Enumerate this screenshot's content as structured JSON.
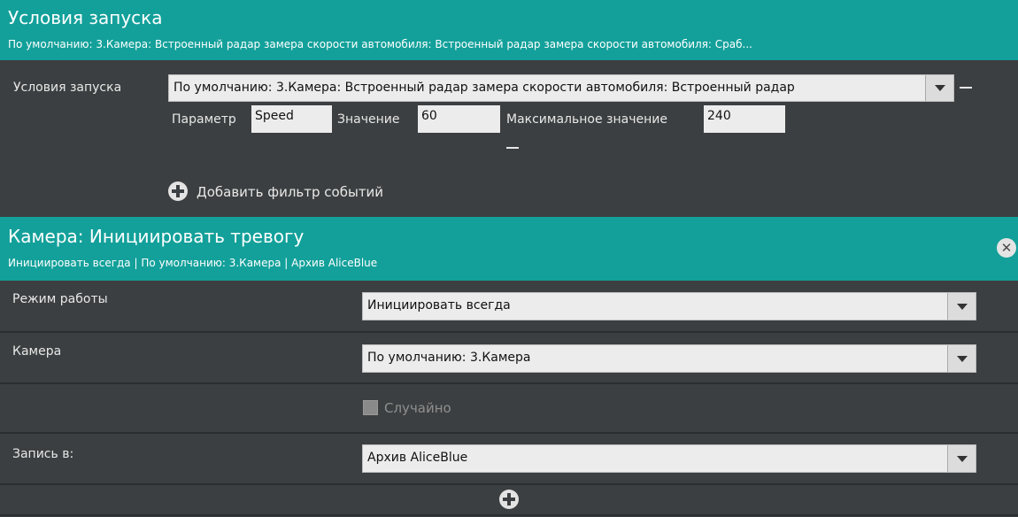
{
  "launch": {
    "title": "Условия запуска",
    "subtitle": "По умолчанию: 3.Камера: Встроенный радар замера скорости автомобиля: Встроенный радар замера скорости автомобиля: Сраб...",
    "row_label": "Условия запуска",
    "condition_value": "По умолчанию: 3.Камера: Встроенный радар замера скорости автомобиля: Встроенный радар",
    "param_label": "Параметр",
    "param_value": "Speed",
    "value_label": "Значение",
    "value_value": "60",
    "max_label": "Максимальное значение",
    "max_value": "240",
    "add_filter": "Добавить фильтр событий"
  },
  "action": {
    "title": "Камера: Инициировать тревогу",
    "subtitle": "Инициировать всегда | По умолчанию: 3.Камера | Архив AliceBlue",
    "close_icon": "close-icon",
    "mode_label": "Режим работы",
    "mode_value": "Инициировать всегда",
    "camera_label": "Камера",
    "camera_value": "По умолчанию: 3.Камера",
    "random_label": "Случайно",
    "record_label": "Запись в:",
    "record_value": "Архив AliceBlue"
  },
  "colors": {
    "header": "#13a09a",
    "panel": "#3c3f41"
  }
}
